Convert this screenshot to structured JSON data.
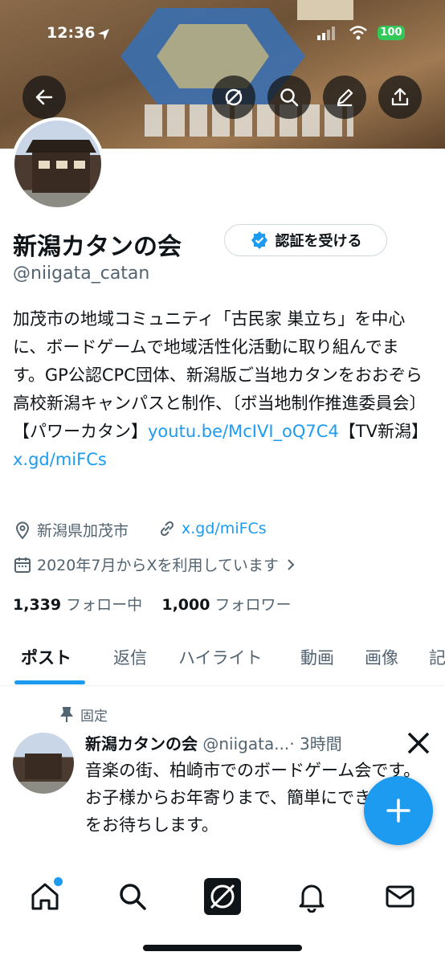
{
  "status_bar": {
    "time": "12:36",
    "battery": "100"
  },
  "profile": {
    "display_name": "新潟カタンの会",
    "verify_label": "認証を受ける",
    "handle": "@niigata_catan",
    "bio_text": "加茂市の地域コミュニティ「古民家 巣立ち」を中心に、ボードゲームで地域活性化活動に取り組んでます。GP公認CPC団体、新潟版ご当地カタンをおおぞら高校新潟キャンパスと制作、〔ボ当地制作推進委員会〕【パワーカタン】",
    "bio_link1": "youtu.be/McIVI_oQ7C4",
    "bio_mid": "【TV新潟】",
    "bio_link2": "x.gd/miFCs",
    "location": "新潟県加茂市",
    "website": "x.gd/miFCs",
    "joined": "2020年7月からXを利用しています",
    "following_count": "1,339",
    "following_label": "フォロー中",
    "followers_count": "1,000",
    "followers_label": "フォロワー"
  },
  "tabs": [
    {
      "label": "ポスト"
    },
    {
      "label": "返信"
    },
    {
      "label": "ハイライト"
    },
    {
      "label": "動画"
    },
    {
      "label": "画像"
    },
    {
      "label": "記"
    }
  ],
  "pinned_post": {
    "pinned_label": "固定",
    "author_name": "新潟カタンの会",
    "author_handle": "@niigata...",
    "time": "· 3時間",
    "text": "音楽の街、柏崎市でのボードゲーム会です。\nお子様からお年寄りまで、簡単にできる作品をお待ちします。"
  },
  "colors": {
    "accent": "#1d9bf0",
    "text": "#0f1419",
    "muted": "#536471"
  },
  "icons": {
    "header": [
      "back-arrow-icon",
      "grok-icon",
      "search-icon",
      "edit-icon",
      "share-icon"
    ],
    "nav": [
      "home-icon",
      "search-icon",
      "grok-icon",
      "bell-icon",
      "mail-icon"
    ]
  }
}
